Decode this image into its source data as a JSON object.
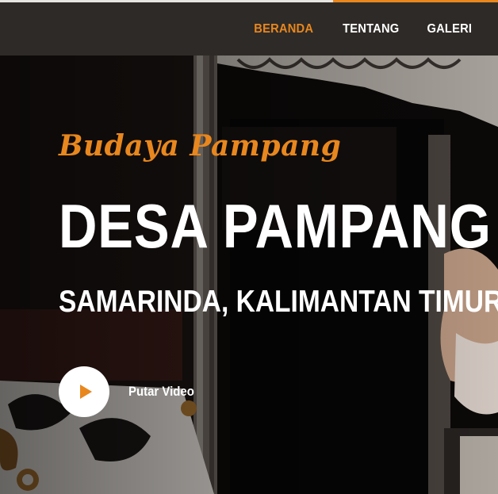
{
  "nav": {
    "items": [
      {
        "label": "BERANDA",
        "active": true
      },
      {
        "label": "TENTANG",
        "active": false
      },
      {
        "label": "GALERI",
        "active": false
      }
    ]
  },
  "hero": {
    "tagline": "Budaya Pampang",
    "title": "DESA PAMPANG",
    "subtitle": "SAMARINDA, KALIMANTAN TIMUR",
    "play_label": "Putar Video"
  },
  "colors": {
    "accent": "#e8871e",
    "navbar": "#2e2a27",
    "text": "#ffffff"
  },
  "icons": {
    "play": "play-icon"
  }
}
